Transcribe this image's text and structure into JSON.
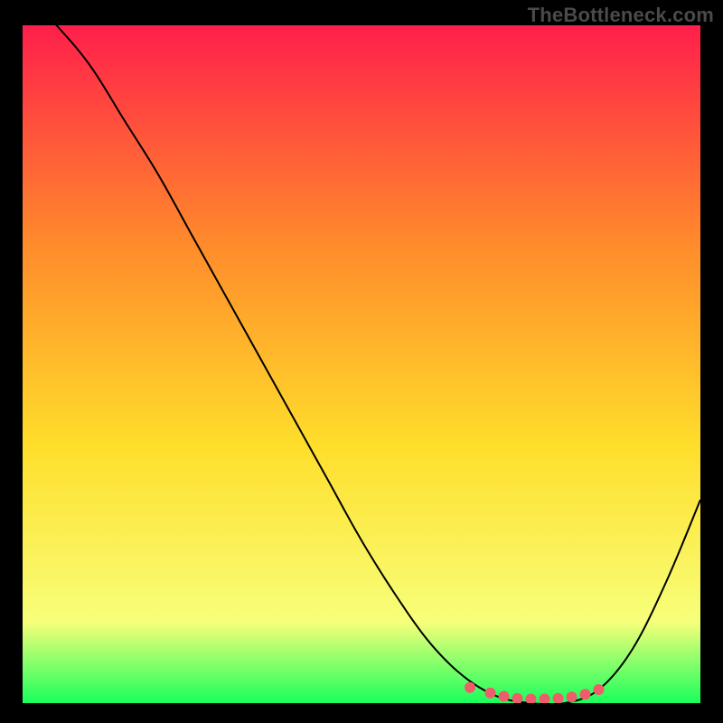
{
  "watermark": "TheBottleneck.com",
  "chart_data": {
    "type": "line",
    "title": "",
    "xlabel": "",
    "ylabel": "",
    "xlim": [
      0,
      100
    ],
    "ylim": [
      0,
      100
    ],
    "background_gradient": {
      "top": "#ff1f4b",
      "upper_mid": "#ff8a2b",
      "mid": "#ffde2b",
      "lower_mid": "#f7ff7a",
      "bottom": "#19ff5c"
    },
    "series": [
      {
        "name": "main-curve",
        "color": "#000000",
        "width": 2,
        "x": [
          0,
          5,
          10,
          15,
          20,
          25,
          30,
          35,
          40,
          45,
          50,
          55,
          60,
          65,
          70,
          75,
          80,
          85,
          90,
          95,
          100
        ],
        "y": [
          105,
          100,
          94,
          86,
          78,
          69,
          60,
          51,
          42,
          33,
          24,
          16,
          9,
          4,
          1,
          0,
          0,
          2,
          8,
          18,
          30
        ]
      },
      {
        "name": "bottom-markers",
        "color": "#ef5d6a",
        "type": "scatter",
        "x": [
          66,
          69,
          71,
          73,
          75,
          77,
          79,
          81,
          83,
          85
        ],
        "y": [
          2.3,
          1.5,
          1.0,
          0.7,
          0.6,
          0.6,
          0.7,
          0.9,
          1.3,
          2.0
        ]
      }
    ]
  }
}
